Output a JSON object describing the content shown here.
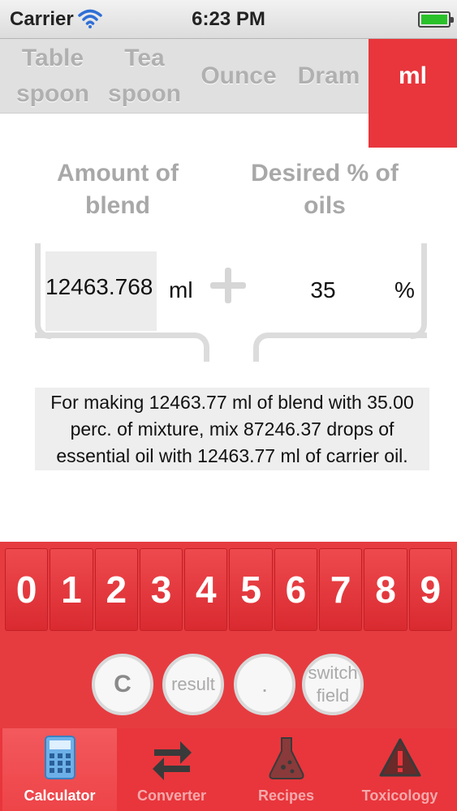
{
  "status_bar": {
    "carrier": "Carrier",
    "time": "6:23 PM",
    "battery_level": 1.0
  },
  "unit_tabs": [
    {
      "label": "Table spoon",
      "line1": "Table",
      "line2": "spoon",
      "active": false
    },
    {
      "label": "Tea spoon",
      "line1": "Tea",
      "line2": "spoon",
      "active": false
    },
    {
      "label": "Ounce",
      "active": false
    },
    {
      "label": "Dram",
      "active": false
    },
    {
      "label": "ml",
      "active": true
    }
  ],
  "calculator": {
    "amount_label_line1": "Amount of",
    "amount_label_line2": "blend",
    "percent_label_line1": "Desired % of",
    "percent_label_line2": "oils",
    "amount_value": "12463.768",
    "amount_unit": "ml",
    "percent_value": "35",
    "percent_unit": "%",
    "result_line1": "For making 12463.77 ml of blend with 35.00",
    "result_line2": "perc. of mixture, mix 87246.37 drops of",
    "result_line3": "essential oil with 12463.77 ml of carrier oil."
  },
  "keypad": {
    "digits": [
      "0",
      "1",
      "2",
      "3",
      "4",
      "5",
      "6",
      "7",
      "8",
      "9"
    ],
    "clear_label": "C",
    "result_label": "result",
    "decimal_label": ".",
    "switch_line1": "switch",
    "switch_line2": "field"
  },
  "tab_bar": {
    "items": [
      {
        "label": "Calculator",
        "icon": "calculator-icon",
        "selected": true
      },
      {
        "label": "Converter",
        "icon": "swap-arrows-icon",
        "selected": false
      },
      {
        "label": "Recipes",
        "icon": "flask-icon",
        "selected": false
      },
      {
        "label": "Toxicology",
        "icon": "warning-icon",
        "selected": false
      }
    ]
  },
  "colors": {
    "accent_red": "#e8363c",
    "label_gray": "#a8a8a8"
  }
}
